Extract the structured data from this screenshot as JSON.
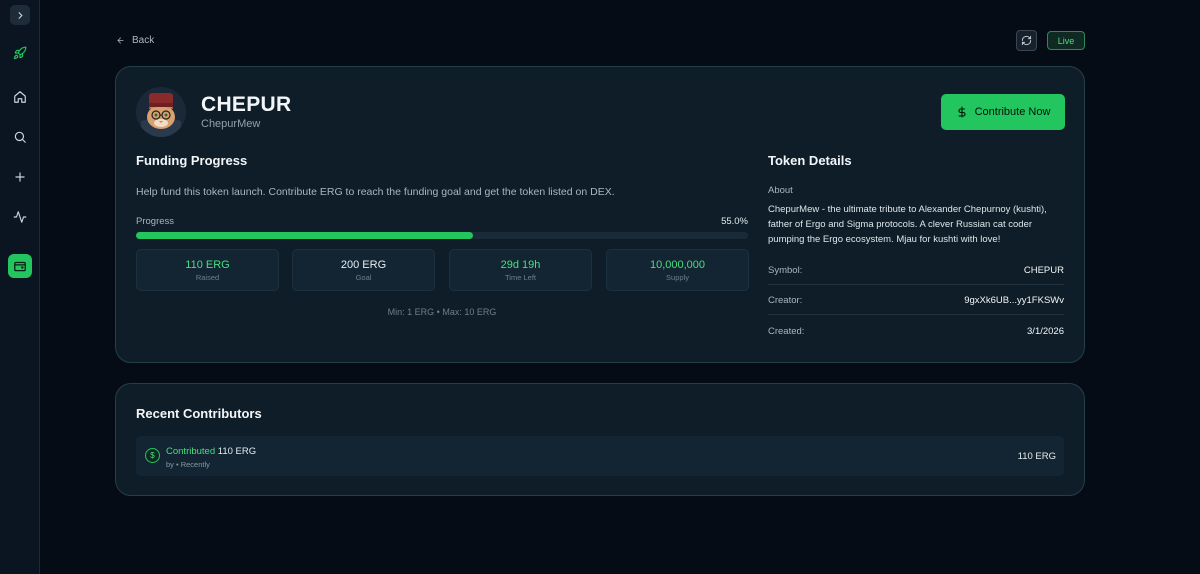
{
  "sidebar": {
    "toggle_icon": "chevron-right-icon",
    "items": [
      {
        "icon": "rocket-icon",
        "active": false
      },
      {
        "icon": "home-icon",
        "active": false
      },
      {
        "icon": "search-icon",
        "active": false
      },
      {
        "icon": "plus-icon",
        "active": false
      },
      {
        "icon": "activity-icon",
        "active": false
      },
      {
        "icon": "wallet-icon",
        "active": true
      }
    ]
  },
  "header": {
    "back_label": "Back",
    "live_label": "Live"
  },
  "token": {
    "name": "CHEPUR",
    "ticker": "ChepurMew",
    "contribute_label": "Contribute Now"
  },
  "funding": {
    "title": "Funding Progress",
    "description": "Help fund this token launch. Contribute ERG to reach the funding goal and get the token listed on DEX.",
    "progress_label": "Progress",
    "progress_pct": "55.0%",
    "progress_value": 0.55,
    "stats": [
      {
        "value": "110 ERG",
        "label": "Raised",
        "accent": true
      },
      {
        "value": "200 ERG",
        "label": "Goal",
        "accent": false
      },
      {
        "value": "29d 19h",
        "label": "Time Left",
        "accent": true
      },
      {
        "value": "10,000,000",
        "label": "Supply",
        "accent": true
      }
    ],
    "limits": "Min: 1 ERG • Max: 10 ERG"
  },
  "details": {
    "title": "Token Details",
    "about_label": "About",
    "about_text": "ChepurMew - the ultimate tribute to Alexander Chepurnoy (kushti), father of Ergo and Sigma protocols. A clever Russian cat coder pumping the Ergo ecosystem. Mjau for kushti with love!",
    "rows": [
      {
        "key": "Symbol:",
        "value": "CHEPUR"
      },
      {
        "key": "Creator:",
        "value": "9gxXk6UB...yy1FKSWv"
      },
      {
        "key": "Created:",
        "value": "3/1/2026"
      }
    ]
  },
  "contributors": {
    "title": "Recent Contributors",
    "items": [
      {
        "action": "Contributed",
        "amount_text": "110 ERG",
        "meta": "by • Recently",
        "amount": "110 ERG"
      }
    ]
  },
  "colors": {
    "accent": "#22c55e",
    "background": "#050c15",
    "card": "#0e1d27"
  }
}
